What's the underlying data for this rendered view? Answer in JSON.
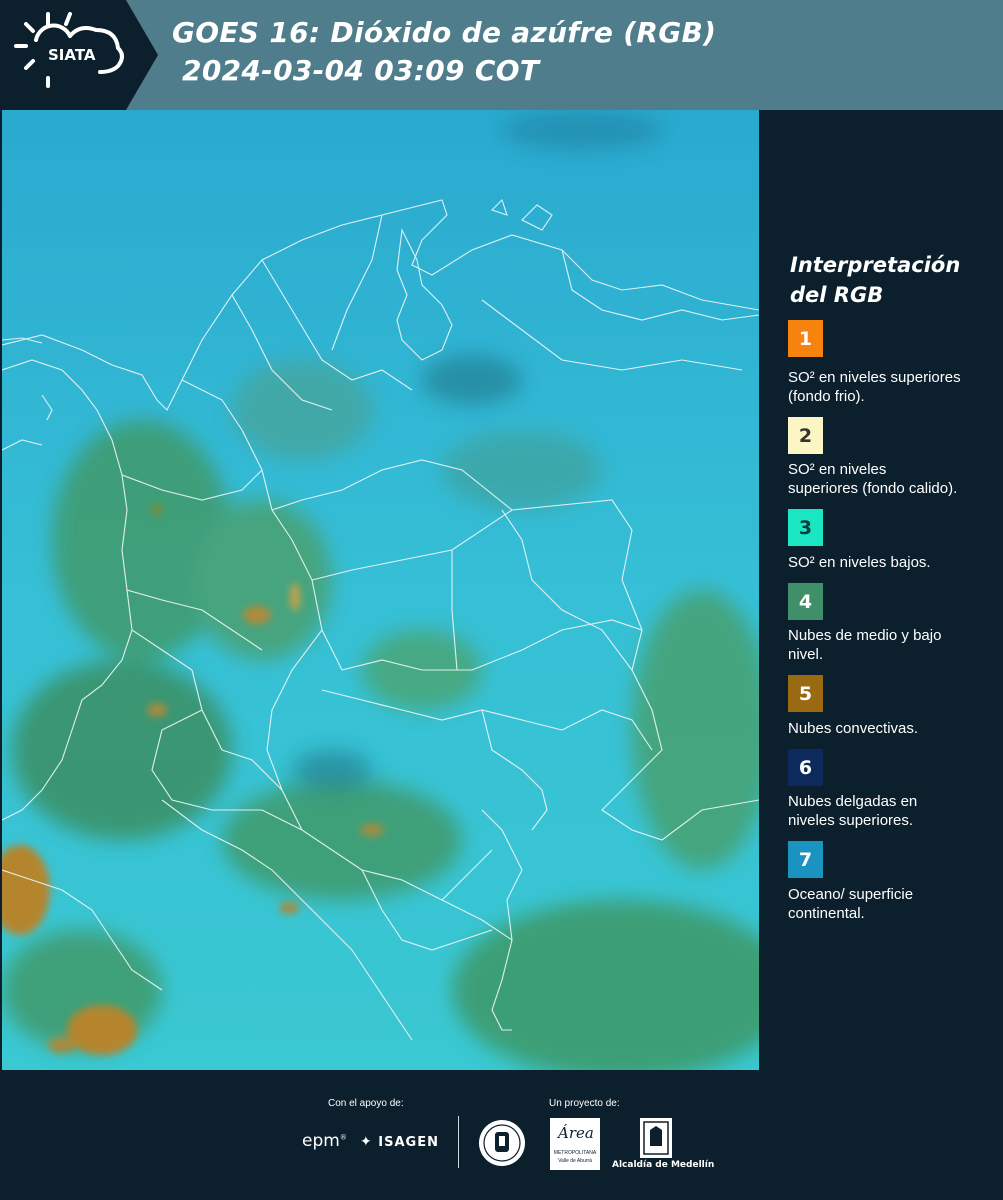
{
  "header": {
    "logo_text": "SIATA",
    "title_line1": "GOES 16: Dióxido de azúfre (RGB)",
    "title_line2": " 2024-03-04 03:09 COT"
  },
  "legend": {
    "title": "Interpretación del RGB",
    "items": [
      {
        "number": "1",
        "color": "#f7830f",
        "text_color": "#ffffff",
        "label": "SO² en niveles superiores (fondo frio)."
      },
      {
        "number": "2",
        "color": "#fcf5c4",
        "text_color": "#333333",
        "label": "SO² en niveles superiores (fondo calido)."
      },
      {
        "number": "3",
        "color": "#1be6c4",
        "text_color": "#0c3a3a",
        "label": "SO² en niveles bajos."
      },
      {
        "number": "4",
        "color": "#3f8f68",
        "text_color": "#ffffff",
        "label": "Nubes de medio y bajo nivel."
      },
      {
        "number": "5",
        "color": "#9a6a12",
        "text_color": "#ffffff",
        "label": "Nubes convectivas."
      },
      {
        "number": "6",
        "color": "#0c2a5c",
        "text_color": "#ffffff",
        "label": "Nubes delgadas en niveles superiores."
      },
      {
        "number": "7",
        "color": "#1a93c0",
        "text_color": "#ffffff",
        "label": "Oceano/ superficie continental."
      }
    ]
  },
  "footer": {
    "support_label": "Con el apoyo de:",
    "project_label": "Un proyecto de:",
    "sponsor_epm": "epm",
    "sponsor_isagen": "ISAGEN",
    "logo_area": "Área",
    "logo_area_sub": "METROPOLITANA",
    "logo_area_sub2": "Valle de Aburrá",
    "logo_alcaldia": "Alcaldía de Medellín"
  },
  "colors": {
    "header_bg": "#4f7d8b",
    "page_bg": "#0c1f2c",
    "map_cyan": "#33bcd6",
    "map_green": "#3f9a6a",
    "map_convective": "#b5852e"
  }
}
